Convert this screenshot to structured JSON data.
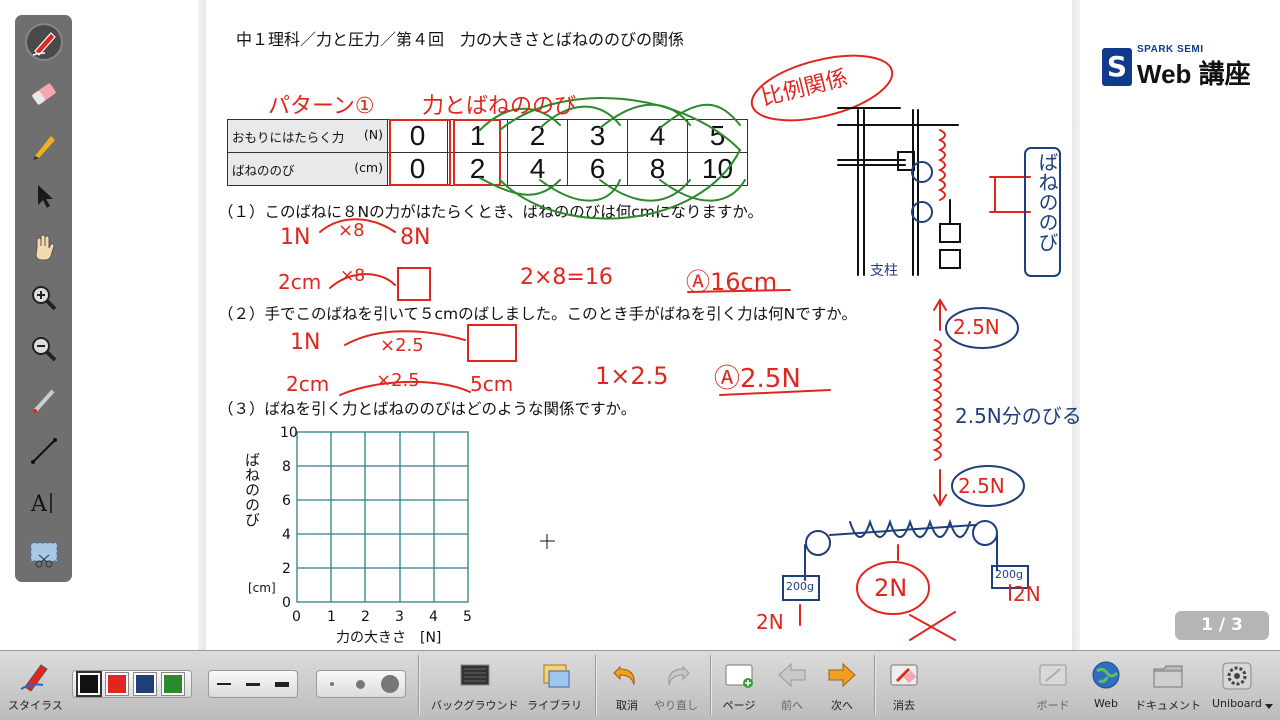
{
  "worksheet": {
    "title": "中１理科／力と圧力／第４回　力の大きさとばねののびの関係",
    "table": {
      "row1_label": "おもりにはたらく力",
      "row1_unit": "(N)",
      "row2_label": "ばねののび",
      "row2_unit": "(cm)",
      "force_values": [
        "0",
        "1",
        "2",
        "3",
        "4",
        "5"
      ],
      "stretch_values": [
        "0",
        "2",
        "4",
        "6",
        "8",
        "10"
      ]
    },
    "q1": "（１）このばねに８Nの力がはたらくとき、ばねののびは何cmになりますか。",
    "q2": "（２）手でこのばねを引いて５cmのばしました。このとき手がばねを引く力は何Nですか。",
    "q3": "（３）ばねを引く力とばねののびはどのような関係ですか。",
    "graph": {
      "y_ticks": [
        "0",
        "2",
        "4",
        "6",
        "8",
        "10"
      ],
      "x_ticks": [
        "0",
        "1",
        "2",
        "3",
        "4",
        "5"
      ],
      "y_label": "ばねののび",
      "y_unit": "[cm]",
      "x_label": "力の大きさ　[N]"
    }
  },
  "annotations": {
    "pattern": "パターン①",
    "relation": "力とばねののび",
    "proportional": "比例関係",
    "q1_a": "1N",
    "q1_b": "×8",
    "q1_c": "8N",
    "q1_d": "2cm",
    "q1_e": "×8",
    "q1_calc": "2×8=16",
    "q1_answer": "Ⓐ16cm",
    "q2_a": "1N",
    "q2_b": "×2.5",
    "q2_d": "2cm",
    "q2_e": "×2.5",
    "q2_f": "5cm",
    "q2_calc": "1×2.5",
    "q2_answer": "Ⓐ2.5N",
    "spring_force_top": "2.5N",
    "spring_note": "2.5N分のびる",
    "spring_force_bottom": "2.5N",
    "center_force": "2N",
    "weight_left": "200g",
    "weight_right": "200g",
    "force_left": "2N",
    "force_right": "2N",
    "stretch_label": "ばねののび",
    "stand_label": "支柱"
  },
  "logo": {
    "tagline": "SPARK SEMI",
    "name": "Web 講座"
  },
  "page_indicator": "1 / 3",
  "toolbar": {
    "stylus": "スタイラス",
    "background": "バックグラウンド",
    "library": "ライブラリ",
    "undo": "取消",
    "redo": "やり直し",
    "page": "ページ",
    "prev": "前へ",
    "next": "次へ",
    "erase": "消去",
    "board": "ボード",
    "web": "Web",
    "document": "ドキュメント",
    "uniboard": "Uniboard"
  },
  "colors": {
    "ink_red": "#e0261e",
    "ink_green": "#2b8a2b",
    "ink_blue": "#1f3f7a",
    "grid": "#2e7f86",
    "accent_orange": "#f0a020"
  }
}
